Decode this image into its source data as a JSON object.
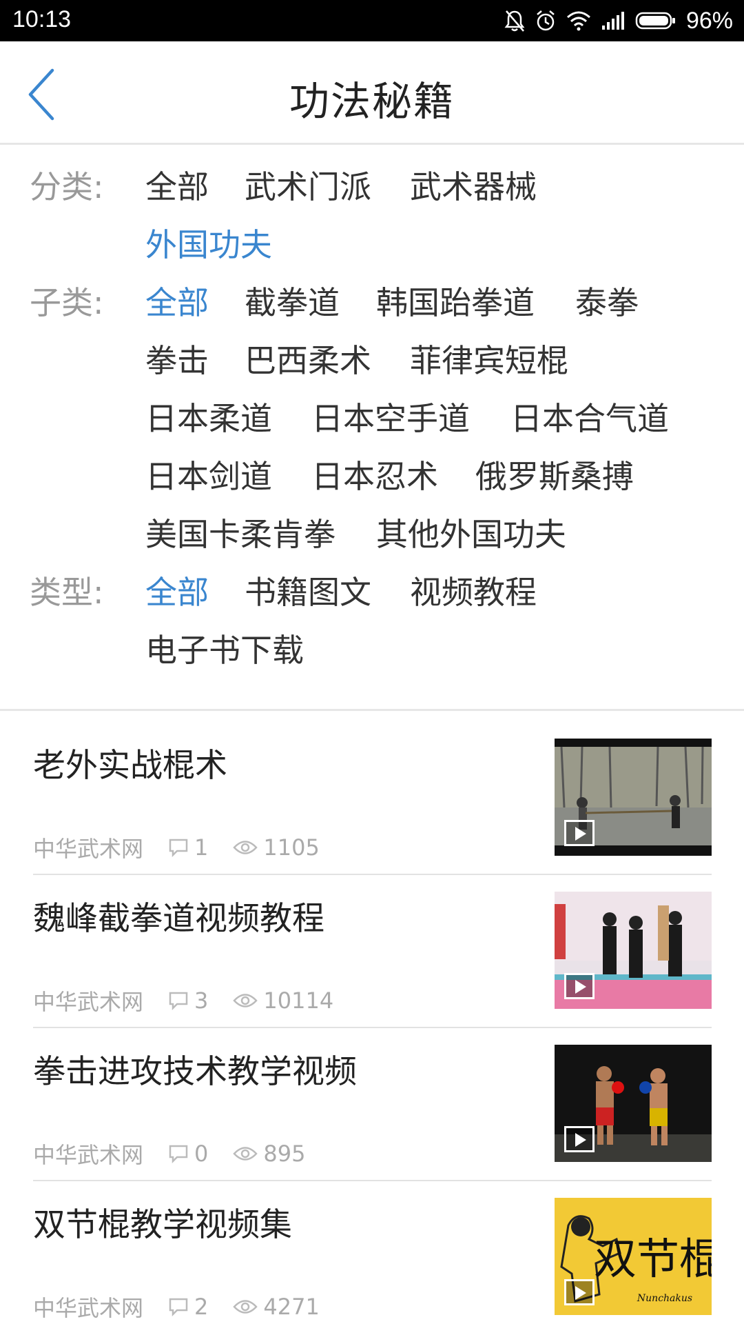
{
  "status_bar": {
    "time": "10:13",
    "battery": "96%",
    "icons": [
      "mute-bell-icon",
      "alarm-icon",
      "wifi-icon",
      "signal-icon",
      "battery-icon"
    ]
  },
  "header": {
    "title": "功法秘籍",
    "back_icon": "chevron-left-icon",
    "accent_color": "#3a86cf"
  },
  "filters": {
    "category": {
      "label": "分类:",
      "items": [
        "全部",
        "武术门派",
        "武术器械",
        "外国功夫"
      ],
      "selected": "外国功夫"
    },
    "subcategory": {
      "label": "子类:",
      "items": [
        "全部",
        "截拳道",
        "韩国跆拳道",
        "泰拳",
        "拳击",
        "巴西柔术",
        "菲律宾短棍",
        "日本柔道",
        "日本空手道",
        "日本合气道",
        "日本剑道",
        "日本忍术",
        "俄罗斯桑搏",
        "美国卡柔肯拳",
        "其他外国功夫"
      ],
      "selected": "全部"
    },
    "type": {
      "label": "类型:",
      "items": [
        "全部",
        "书籍图文",
        "视频教程",
        "电子书下载"
      ],
      "selected": "全部"
    }
  },
  "articles": [
    {
      "title": "老外实战棍术",
      "source": "中华武术网",
      "comments": "1",
      "views": "1105",
      "thumbnail": "video-thumbnail-stick-fighting-outdoors"
    },
    {
      "title": "魏峰截拳道视频教程",
      "source": "中华武术网",
      "comments": "3",
      "views": "10114",
      "thumbnail": "video-thumbnail-jkd-studio"
    },
    {
      "title": "拳击进攻技术教学视频",
      "source": "中华武术网",
      "comments": "0",
      "views": "895",
      "thumbnail": "video-thumbnail-boxing"
    },
    {
      "title": "双节棍教学视频集",
      "source": "中华武术网",
      "comments": "2",
      "views": "4271",
      "thumbnail": "video-thumbnail-nunchaku",
      "thumb_text": "双节棍",
      "thumb_subtext": "Nunchakus"
    }
  ]
}
